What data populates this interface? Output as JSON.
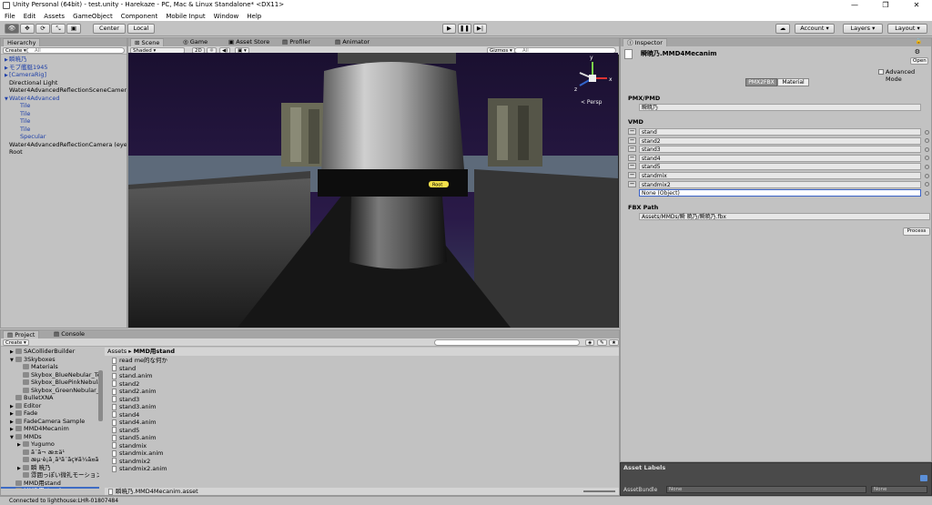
{
  "window": {
    "title": "Unity Personal (64bit) - test.unity - Harekaze - PC, Mac & Linux Standalone* <DX11>",
    "minimize": "—",
    "maximize": "❐",
    "close": "✕"
  },
  "menu": [
    "File",
    "Edit",
    "Assets",
    "GameObject",
    "Component",
    "Mobile Input",
    "Window",
    "Help"
  ],
  "toolbar": {
    "center": "Center",
    "local": "Local",
    "account": "Account",
    "layers": "Layers",
    "layout": "Layout"
  },
  "hierarchy": {
    "tab": "Hierarchy",
    "create": "Create",
    "search_placeholder": "All",
    "items": [
      {
        "label": "瞬暁乃",
        "indent": 0,
        "arrow": "▶",
        "blue": true
      },
      {
        "label": "モブ艦艇1945",
        "indent": 0,
        "arrow": "▶",
        "blue": true
      },
      {
        "label": "[CameraRig]",
        "indent": 0,
        "arrow": "▶",
        "blue": true
      },
      {
        "label": "Directional Light",
        "indent": 0,
        "arrow": "",
        "blue": false
      },
      {
        "label": "Water4AdvancedReflectionSceneCamera",
        "indent": 0,
        "arrow": "",
        "blue": false
      },
      {
        "label": "Water4Advanced",
        "indent": 0,
        "arrow": "▼",
        "blue": true
      },
      {
        "label": "Tile",
        "indent": 1,
        "arrow": "",
        "blue": true
      },
      {
        "label": "Tile",
        "indent": 1,
        "arrow": "",
        "blue": true
      },
      {
        "label": "Tile",
        "indent": 1,
        "arrow": "",
        "blue": true
      },
      {
        "label": "Tile",
        "indent": 1,
        "arrow": "",
        "blue": true
      },
      {
        "label": "Specular",
        "indent": 1,
        "arrow": "",
        "blue": true
      },
      {
        "label": "Water4AdvancedReflectionCamera (eye)",
        "indent": 0,
        "arrow": "",
        "blue": false
      },
      {
        "label": "Root",
        "indent": 0,
        "arrow": "",
        "blue": false
      }
    ]
  },
  "scene": {
    "tabs": [
      "Scene",
      "Game",
      "Asset Store",
      "Profiler",
      "Animator"
    ],
    "shading": "Shaded",
    "mode_2d": "2D",
    "gizmos": "Gizmos",
    "search_placeholder": "All",
    "persp": "< Persp",
    "root_label": "Root",
    "gizmo_axes": {
      "y": "y",
      "x": "x",
      "z": "z"
    }
  },
  "inspector": {
    "tab": "Inspector",
    "object_name": "瞬暁乃.MMD4Mecanim",
    "open": "Open",
    "advanced_mode": "Advanced Mode",
    "tab_pmx2fbx": "PMX2FBX",
    "tab_material": "Material",
    "pmx_section": "PMX/PMD",
    "pmx_value": "瞬暁乃",
    "vmd_section": "VMD",
    "vmd_items": [
      "stand",
      "stand2",
      "stand3",
      "stand4",
      "stand5",
      "standmix",
      "standmix2"
    ],
    "none_object": "None (Object)",
    "fbx_section": "FBX Path",
    "fbx_value": "Assets/MMDs/瞬 暁乃/瞬暁乃.fbx",
    "process": "Process",
    "asset_labels": "Asset Labels",
    "asset_bundle": "AssetBundle",
    "bundle_a": "None",
    "bundle_b": "None"
  },
  "project": {
    "tabs": [
      "Project",
      "Console"
    ],
    "create": "Create",
    "breadcrumb": [
      "Assets",
      "MMD用stand"
    ],
    "tree": [
      {
        "label": "SAColliderBuilder",
        "indent": 1,
        "arrow": "▶"
      },
      {
        "label": "3Skyboxes",
        "indent": 1,
        "arrow": "▼"
      },
      {
        "label": "Materials",
        "indent": 2,
        "arrow": ""
      },
      {
        "label": "Skybox_BlueNebular_Te",
        "indent": 2,
        "arrow": ""
      },
      {
        "label": "Skybox_BluePinkNebula",
        "indent": 2,
        "arrow": ""
      },
      {
        "label": "Skybox_GreenNebular_",
        "indent": 2,
        "arrow": ""
      },
      {
        "label": "BulletXNA",
        "indent": 1,
        "arrow": ""
      },
      {
        "label": "Editor",
        "indent": 1,
        "arrow": "▶"
      },
      {
        "label": "Fade",
        "indent": 1,
        "arrow": "▶"
      },
      {
        "label": "FadeCamera Sample",
        "indent": 1,
        "arrow": "▶"
      },
      {
        "label": "MMD4Mecanim",
        "indent": 1,
        "arrow": "▶"
      },
      {
        "label": "MMDs",
        "indent": 1,
        "arrow": "▼"
      },
      {
        "label": "Yugumo",
        "indent": 2,
        "arrow": "▶"
      },
      {
        "label": "ã¨ã¬ æ±ä¹",
        "indent": 2,
        "arrow": ""
      },
      {
        "label": "æµ·è¡ã¸ã³ã¨ãç¥ã¼ã¤ã",
        "indent": 2,
        "arrow": ""
      },
      {
        "label": "瞬 暁乃",
        "indent": 2,
        "arrow": "▶"
      },
      {
        "label": "雰囲っぽい微礼モーション",
        "indent": 2,
        "arrow": ""
      },
      {
        "label": "MMD用stand",
        "indent": 1,
        "arrow": ""
      },
      {
        "label": "MMD用stand",
        "indent": 1,
        "arrow": ""
      }
    ],
    "files": [
      "read me的な何か",
      "stand",
      "stand.anim",
      "stand2",
      "stand2.anim",
      "stand3",
      "stand3.anim",
      "stand4",
      "stand4.anim",
      "stand5",
      "stand5.anim",
      "standmix",
      "standmix.anim",
      "standmix2",
      "standmix2.anim"
    ],
    "selected_asset": "瞬暁乃.MMD4Mecanim.asset"
  },
  "status": "Connected to lighthouse:LHR-01807484"
}
